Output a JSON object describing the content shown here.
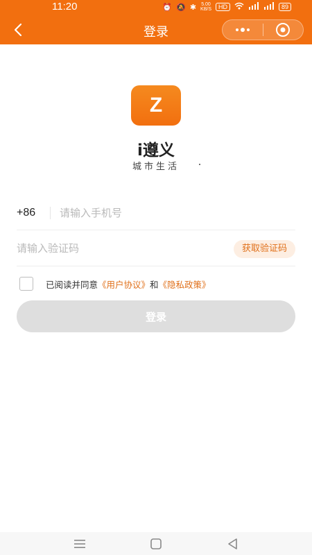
{
  "status_bar": {
    "time": "11:20",
    "net_speed": "5.00\nKB/S",
    "hd_label": "HD",
    "signal1": "5G",
    "signal2": "5G",
    "battery": "89"
  },
  "nav": {
    "title": "登录",
    "back_icon": "chevron-left-icon",
    "more_icon": "more-dots-icon",
    "close_icon": "target-close-icon"
  },
  "brand": {
    "logo_letter": "Z",
    "app_name": "i遵义",
    "subtitle": "城市生活",
    "accent_color": "#f26f0f"
  },
  "form": {
    "country_code": "+86",
    "phone_placeholder": "请输入手机号",
    "code_placeholder": "请输入验证码",
    "get_code_label": "获取验证码"
  },
  "agreement": {
    "prefix": "已阅读并同意",
    "user_agreement": "《用户协议》",
    "and": "和",
    "privacy_policy": "《隐私政策》"
  },
  "login_button": "登录",
  "system_nav": {
    "menu_icon": "menu-icon",
    "home_icon": "home-icon",
    "back_icon": "back-triangle-icon"
  }
}
